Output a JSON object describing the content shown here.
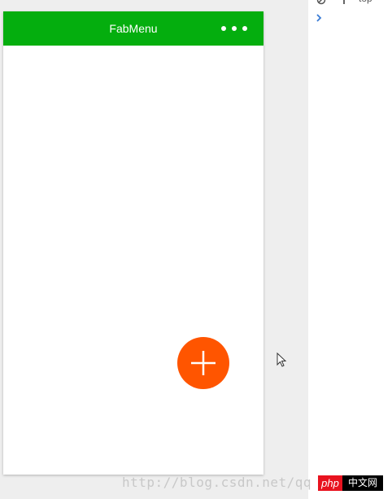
{
  "app": {
    "title": "FabMenu"
  },
  "nav": {
    "more_icon": "more-dots-icon"
  },
  "fab": {
    "icon": "plus-icon",
    "color": "#ff5500"
  },
  "theme": {
    "nav_color": "#04ae0e"
  },
  "devtools": {
    "context": "top",
    "prompt_icon": "console-prompt-icon"
  },
  "watermark": {
    "text": "http://blog.csdn.net/qq"
  },
  "logo": {
    "php": "php",
    "cn": "中文网"
  }
}
